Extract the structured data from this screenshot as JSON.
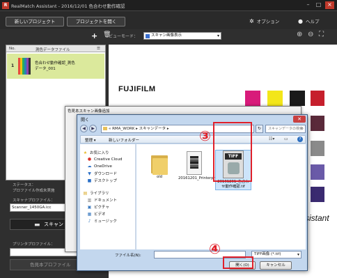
{
  "app": {
    "logo": "R",
    "title": "RealMatch Assistant - 2016/12/01 色合わせ動作確認",
    "minimize": "–",
    "maximize": "□",
    "close": "×"
  },
  "toolbar": {
    "new_project": "新しいプロジェクト",
    "open_project": "プロジェクトを開く",
    "options": "オプション",
    "help": "ヘルプ"
  },
  "sidebar": {
    "add_button": "+",
    "columns": [
      "No.",
      "測色データファイル"
    ],
    "rows": [
      {
        "no": "1",
        "line1": "色合わせ動作確認_測色",
        "line2": "データ_001"
      }
    ],
    "status_label": "ステータス：",
    "status_value": "プロファイル作成未実施",
    "scanner_profile_label": "スキャナプロファイル：",
    "scanner_profile_value": "Scanner_1450GA.icc",
    "scan_button": "スキャン",
    "printer_profile_label": "プリンタプロファイル：",
    "color_profile_button": "色見本プロファイル"
  },
  "viewer": {
    "view_mode_label": "ビューモード：",
    "view_mode_value": "スキャン画像表示",
    "brand": "FUJIFILM",
    "assistant_text": "sistant"
  },
  "back_dialog": {
    "title": "色見本スキャン画像追加"
  },
  "open_dialog": {
    "title": "開く",
    "address": "« RMA_WORK ▸ スキャンデータ ▸",
    "search_placeholder": "スキャンデータの検索",
    "organize": "整理 ▾",
    "new_folder": "新しいフォルダー",
    "nav_items": [
      {
        "icon": "star-icon",
        "label": "お気に入り"
      },
      {
        "icon": "creative-cloud-icon",
        "label": "Creative Cloud"
      },
      {
        "icon": "onedrive-icon",
        "label": "OneDrive"
      },
      {
        "icon": "download-icon",
        "label": "ダウンロード"
      },
      {
        "icon": "desktop-icon",
        "label": "デスクトップ"
      },
      {
        "icon": "library-icon",
        "label": "ライブラリ"
      },
      {
        "icon": "documents-icon",
        "label": "ドキュメント"
      },
      {
        "icon": "pictures-icon",
        "label": "ピクチャ"
      },
      {
        "icon": "video-icon",
        "label": "ビデオ"
      },
      {
        "icon": "music-icon",
        "label": "ミュージック"
      }
    ],
    "files": [
      {
        "name": "old",
        "kind": "folder"
      },
      {
        "name": "20161201_Printerprofile_cset.tif",
        "kind": "doc"
      },
      {
        "name": "20161201_色合わせ動作確認.tif",
        "kind": "tiff",
        "tag": "TIFF"
      }
    ],
    "filename_label": "ファイル名(N):",
    "filetype_value": "TIFF画像 (*.tif)",
    "open_button": "開く(O)",
    "cancel_button": "キャンセル"
  },
  "annotations": {
    "step3": "③",
    "step4": "④"
  },
  "colors": {
    "highlight_red": "#e0202a",
    "selected_row": "#dbe99c",
    "dialog_frame": "#c3d7ee"
  }
}
